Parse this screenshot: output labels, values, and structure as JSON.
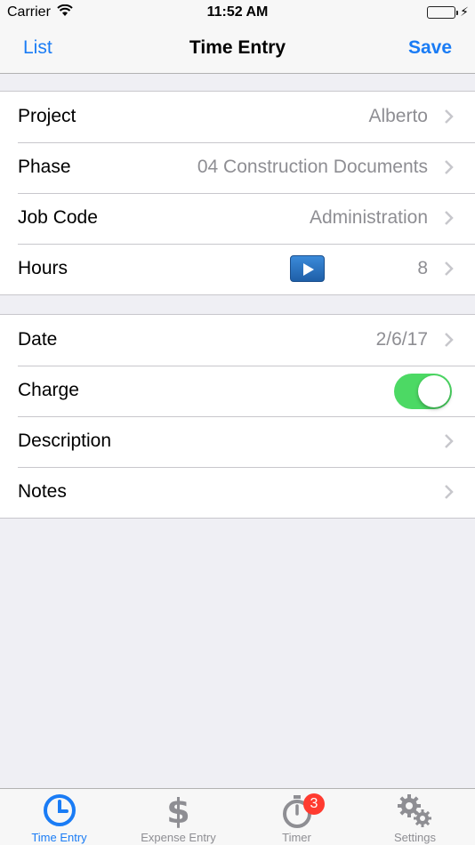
{
  "status_bar": {
    "carrier": "Carrier",
    "time": "11:52 AM"
  },
  "nav": {
    "back_label": "List",
    "title": "Time Entry",
    "save_label": "Save"
  },
  "group1": {
    "project": {
      "label": "Project",
      "value": "Alberto"
    },
    "phase": {
      "label": "Phase",
      "value": "04 Construction Documents"
    },
    "job_code": {
      "label": "Job Code",
      "value": "Administration"
    },
    "hours": {
      "label": "Hours",
      "value": "8"
    }
  },
  "group2": {
    "date": {
      "label": "Date",
      "value": "2/6/17"
    },
    "charge": {
      "label": "Charge",
      "on": true
    },
    "description": {
      "label": "Description"
    },
    "notes": {
      "label": "Notes"
    }
  },
  "tabs": [
    {
      "label": "Time Entry",
      "icon": "clock-icon",
      "active": true
    },
    {
      "label": "Expense Entry",
      "icon": "dollar-icon"
    },
    {
      "label": "Timer",
      "icon": "stopwatch-icon",
      "badge": "3"
    },
    {
      "label": "Settings",
      "icon": "gears-icon"
    }
  ],
  "colors": {
    "accent": "#1a7cf5",
    "toggle_on": "#4cd964",
    "badge": "#ff3b30"
  }
}
